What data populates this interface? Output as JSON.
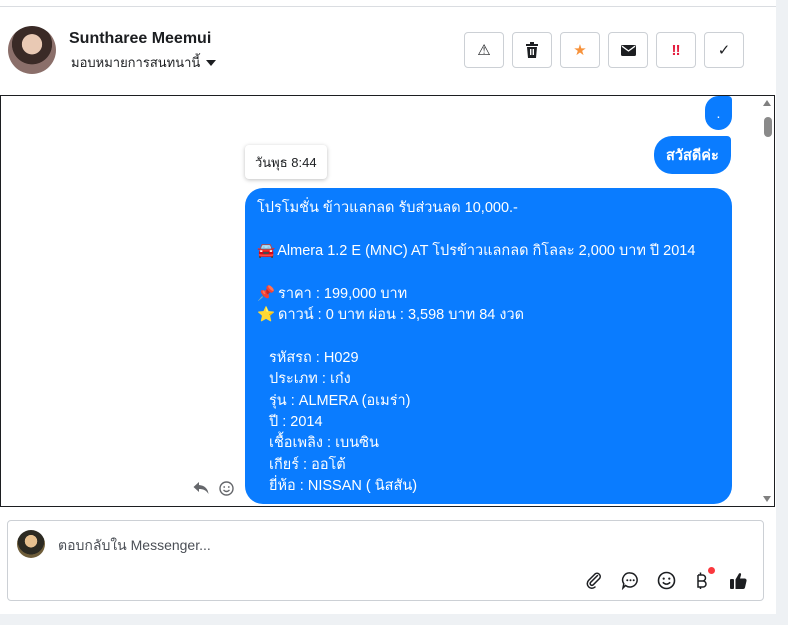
{
  "header": {
    "contact_name": "Suntharee Meemui",
    "assign_label": "มอบหมายการสนทนานี้",
    "actions": [
      {
        "name": "spam-button",
        "icon": "warning-icon",
        "glyph": "⚠",
        "color": "#1c1e21"
      },
      {
        "name": "delete-button",
        "icon": "trash-icon",
        "glyph": "🗑",
        "color": "#1c1e21"
      },
      {
        "name": "star-button",
        "icon": "star-icon",
        "glyph": "★",
        "color": "#f7923b"
      },
      {
        "name": "mark-unread-button",
        "icon": "envelope-icon",
        "glyph": "✉",
        "color": "#1c1e21"
      },
      {
        "name": "follow-up-button",
        "icon": "exclamation-icon",
        "glyph": "‼",
        "color": "#e41e3f"
      },
      {
        "name": "mark-done-button",
        "icon": "check-icon",
        "glyph": "✓",
        "color": "#1c1e21"
      }
    ]
  },
  "thread": {
    "msg_dot": ".",
    "msg_greeting": "สวัสดีค่ะ",
    "timestamp": "วันพุธ 8:44",
    "promo": {
      "line1": "โปรโมชั่น ข้าวแลกลด รับส่วนลด 10,000.-",
      "car_emoji": "🚘",
      "line2": "Almera 1.2 E (MNC) AT โปรข้าวแลกลด กิโลละ 2,000 บาท ปี 2014",
      "pin_emoji": "📌",
      "line3": "ราคา : 199,000 บาท",
      "star_emoji": "⭐",
      "line4": "ดาวน์ : 0 บาท ผ่อน : 3,598 บาท 84 งวด",
      "details": [
        "รหัสรถ : H029",
        "ประเภท : เก๋ง",
        "รุ่น : ALMERA (อเมร่า)",
        "ปี : 2014",
        "เชื้อเพลิง : เบนซิน",
        "เกียร์ : ออโต้",
        "ยี่ห้อ : NISSAN ( นิสสัน)"
      ]
    }
  },
  "composer": {
    "placeholder": "ตอบกลับใน Messenger..."
  },
  "colors": {
    "bubble": "#0a7cff",
    "star": "#f7923b",
    "alert": "#e41e3f"
  }
}
